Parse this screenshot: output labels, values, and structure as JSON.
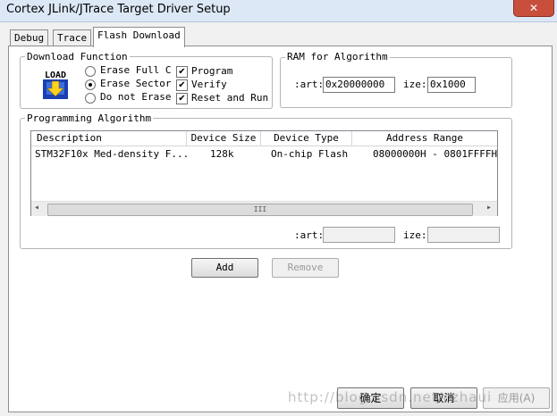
{
  "window": {
    "title": "Cortex JLink/JTrace Target Driver Setup",
    "close_glyph": "✕"
  },
  "tabs": [
    {
      "label": "Debug",
      "active": false
    },
    {
      "label": "Trace",
      "active": false
    },
    {
      "label": "Flash Download",
      "active": true
    }
  ],
  "download_function": {
    "label": "Download Function",
    "icon_text": "LOAD",
    "radios": [
      {
        "label": "Erase Full C",
        "selected": false
      },
      {
        "label": "Erase Sector",
        "selected": true
      },
      {
        "label": "Do not Erase",
        "selected": false
      }
    ],
    "checks": [
      {
        "label": "Program",
        "checked": true
      },
      {
        "label": "Verify",
        "checked": true
      },
      {
        "label": "Reset and Run",
        "checked": true
      }
    ]
  },
  "ram": {
    "label": "RAM for Algorithm",
    "start_label": ":art:",
    "start_value": "0x20000000",
    "size_label": "ize:",
    "size_value": "0x1000"
  },
  "programming_algorithm": {
    "label": "Programming Algorithm",
    "columns": [
      "Description",
      "Device Size",
      "Device Type",
      "Address Range"
    ],
    "rows": [
      {
        "description": "STM32F10x Med-density F...",
        "size": "128k",
        "type": "On-chip Flash",
        "range": "08000000H - 0801FFFFH"
      }
    ],
    "scroll_grip": "III",
    "scroll_left": "◂",
    "scroll_right": "▸",
    "start_label": ":art:",
    "start_value": "",
    "size_label": "ize:",
    "size_value": ""
  },
  "buttons": {
    "add": "Add",
    "remove": "Remove"
  },
  "footer": {
    "ok": "确定",
    "cancel": "取消",
    "apply": "应用(A)"
  },
  "watermark": "http://blog.csdn.net/czhaui"
}
